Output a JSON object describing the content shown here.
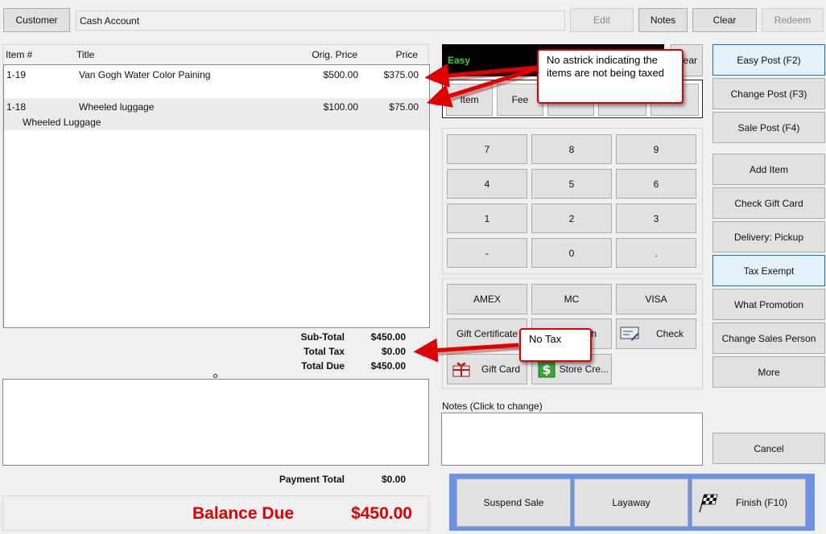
{
  "top": {
    "customer_button": "Customer",
    "customer_value": "Cash Account",
    "edit_button": "Edit",
    "notes_button": "Notes",
    "clear_button": "Clear",
    "redeem_button": "Redeem"
  },
  "items_table": {
    "headers": {
      "item": "Item #",
      "title": "Title",
      "orig_price": "Orig. Price",
      "price": "Price"
    },
    "rows": [
      {
        "item": "1-19",
        "title": "Van Gogh Water Color Paining",
        "orig_price": "$500.00",
        "price": "$375.00",
        "sub": ""
      },
      {
        "item": "1-18",
        "title": "Wheeled luggage",
        "orig_price": "$100.00",
        "price": "$75.00",
        "sub": "Wheeled Luggage"
      }
    ]
  },
  "totals": {
    "subtotal_label": "Sub-Total",
    "subtotal": "$450.00",
    "tax_label": "Total Tax",
    "tax": "$0.00",
    "due_label": "Total Due",
    "due": "$450.00",
    "payment_label": "Payment Total",
    "payment": "$0.00",
    "balance_label": "Balance Due",
    "balance": "$450.00"
  },
  "mode_display": {
    "text": "Easy",
    "clear_label": "ear"
  },
  "mode_buttons": {
    "item": "Item",
    "fee": "Fee"
  },
  "keypad": [
    "7",
    "8",
    "9",
    "4",
    "5",
    "6",
    "1",
    "2",
    "3",
    "-",
    "0",
    "."
  ],
  "tenders": {
    "amex": "AMEX",
    "mc": "MC",
    "visa": "VISA",
    "gift_certificate": "Gift Certificate",
    "cash_partial": "h",
    "check": "Check",
    "gift_card": "Gift Card",
    "store_credit": "Store Cre..."
  },
  "notes": {
    "label": "Notes (Click to change)"
  },
  "actions": {
    "suspend": "Suspend Sale",
    "layaway": "Layaway",
    "finish": "Finish (F10)"
  },
  "right_panel": {
    "easy_post": "Easy Post (F2)",
    "change_post": "Change Post (F3)",
    "sale_post": "Sale Post (F4)",
    "add_item": "Add Item",
    "check_gift_card": "Check Gift Card",
    "delivery": "Delivery: Pickup",
    "tax_exempt": "Tax Exempt",
    "what_promotion": "What Promotion",
    "change_sales_person": "Change Sales Person",
    "more": "More",
    "cancel": "Cancel"
  },
  "annotations": {
    "callout_1": "No astrick indicating the items are not being taxed",
    "callout_2": "No Tax",
    "color": "#e10000"
  }
}
